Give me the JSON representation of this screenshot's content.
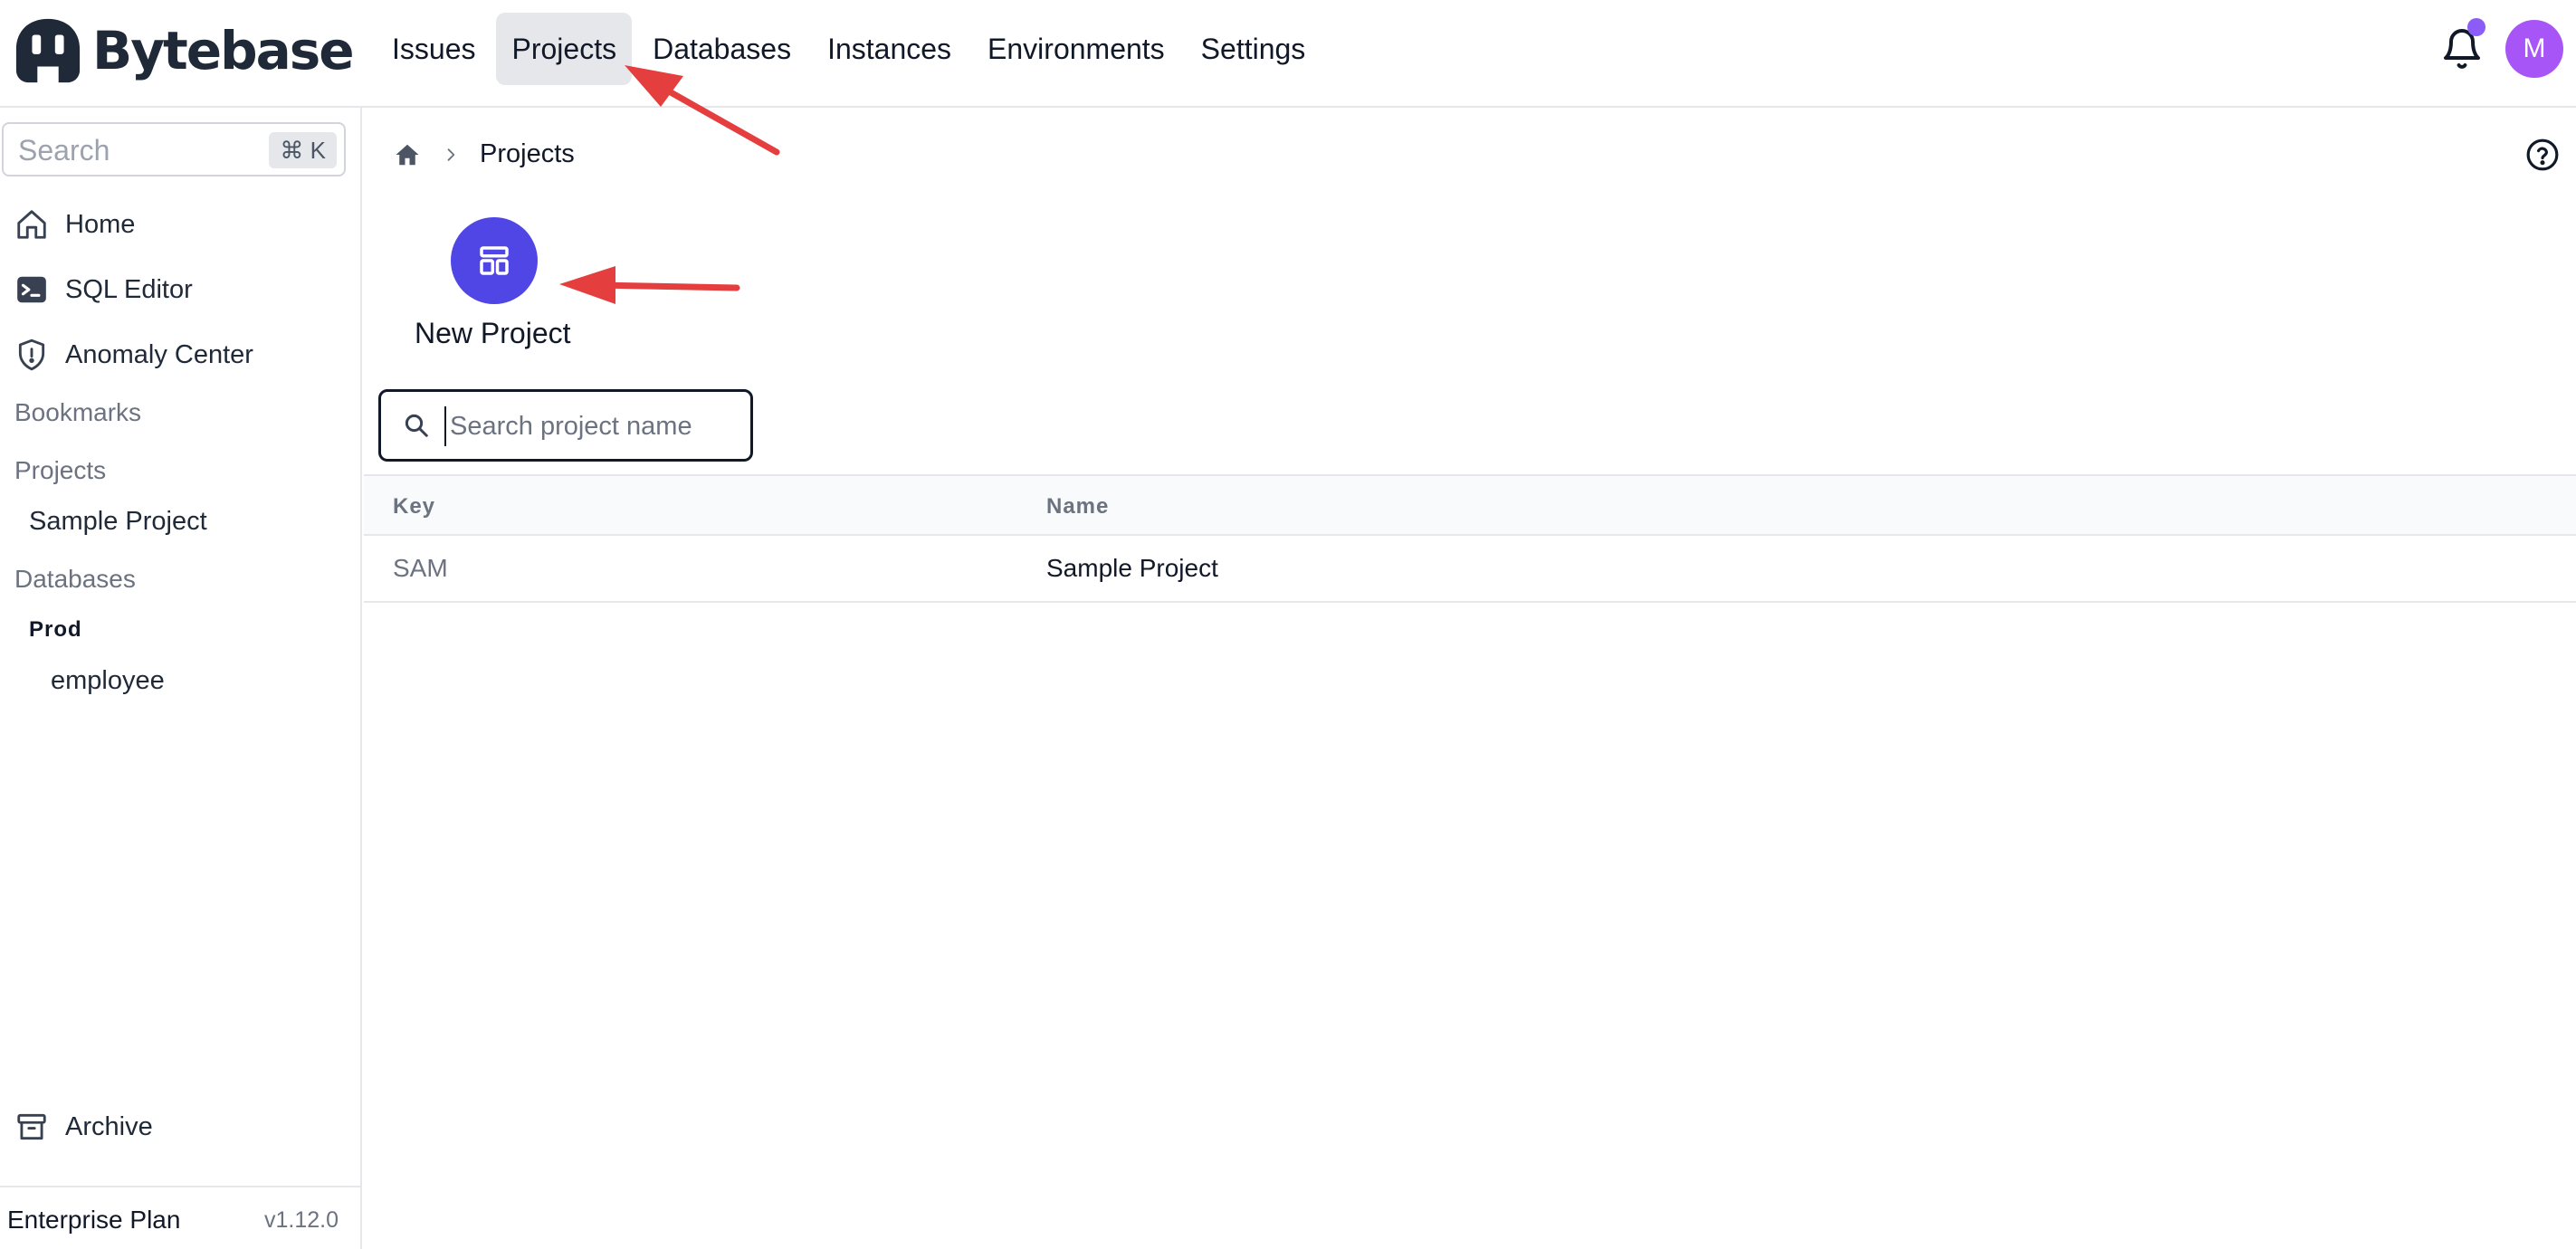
{
  "app": {
    "name": "Bytebase",
    "nav": [
      {
        "label": "Issues",
        "active": false
      },
      {
        "label": "Projects",
        "active": true
      },
      {
        "label": "Databases",
        "active": false
      },
      {
        "label": "Instances",
        "active": false
      },
      {
        "label": "Environments",
        "active": false
      },
      {
        "label": "Settings",
        "active": false
      }
    ],
    "avatar_initial": "M",
    "accent_color": "#4f46e5",
    "avatar_color": "#a855f7"
  },
  "sidebar": {
    "search_placeholder": "Search",
    "search_shortcut": "⌘ K",
    "items": [
      {
        "label": "Home",
        "icon": "home-icon"
      },
      {
        "label": "SQL Editor",
        "icon": "terminal-icon"
      },
      {
        "label": "Anomaly Center",
        "icon": "shield-icon"
      }
    ],
    "bookmarks_label": "Bookmarks",
    "projects_label": "Projects",
    "projects": [
      "Sample Project"
    ],
    "databases_label": "Databases",
    "environment": "Prod",
    "databases": [
      "employee"
    ],
    "archive_label": "Archive",
    "plan": "Enterprise Plan",
    "version": "v1.12.0"
  },
  "main": {
    "breadcrumb_current": "Projects",
    "new_project_label": "New Project",
    "search_placeholder": "Search project name",
    "table": {
      "columns": [
        "Key",
        "Name"
      ],
      "rows": [
        {
          "key": "SAM",
          "name": "Sample Project"
        }
      ]
    }
  }
}
